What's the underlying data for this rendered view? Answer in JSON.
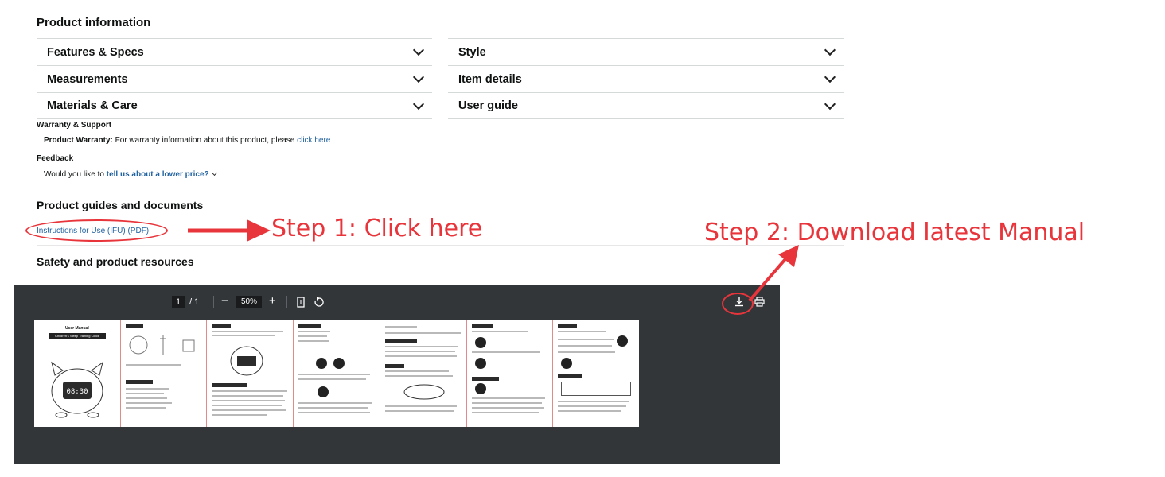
{
  "product_info": {
    "heading": "Product information",
    "left_sections": [
      "Features & Specs",
      "Measurements",
      "Materials & Care"
    ],
    "right_sections": [
      "Style",
      "Item details",
      "User guide"
    ]
  },
  "warranty": {
    "heading": "Warranty & Support",
    "label": "Product Warranty:",
    "text": " For warranty information about this product, please ",
    "link": "click here"
  },
  "feedback": {
    "heading": "Feedback",
    "text": "Would you like to ",
    "link": "tell us about a lower price?"
  },
  "guides": {
    "heading": "Product guides and documents",
    "link": "Instructions for Use (IFU) (PDF)"
  },
  "safety": {
    "heading": "Safety and product resources"
  },
  "annotations": {
    "step1": "Step 1: Click here",
    "step2": "Step 2: Download latest Manual",
    "color": "#e8353b"
  },
  "pdf_viewer": {
    "page_current": "1",
    "page_total": "/ 1",
    "zoom": "50%",
    "minus": "−",
    "plus": "+",
    "thumb_title": "— User Manual —",
    "thumb_subtitle": "Children's Sleep Training Clock",
    "clock_display": "08:30"
  }
}
